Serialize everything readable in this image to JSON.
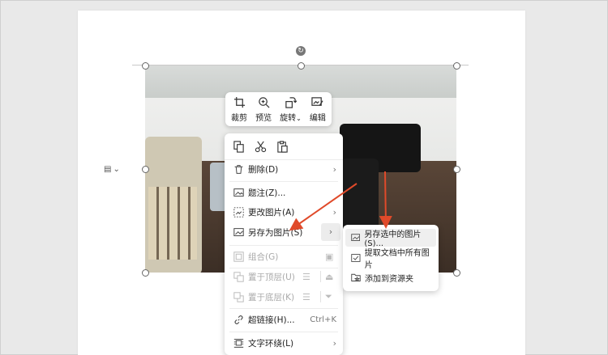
{
  "toolbar": {
    "crop": "裁剪",
    "preview": "预览",
    "rotate": "旋转",
    "edit": "编辑"
  },
  "context_menu": {
    "items": [
      {
        "label": "删除(D)",
        "icon": "trash-icon",
        "has_submenu": true
      },
      {
        "label": "题注(Z)...",
        "icon": "caption-icon"
      },
      {
        "label": "更改图片(A)",
        "icon": "change-image-icon",
        "has_submenu": true
      },
      {
        "label": "另存为图片(S)",
        "icon": "save-image-icon",
        "has_submenu": true
      },
      {
        "label": "组合(G)",
        "icon": "group-icon",
        "disabled": true
      },
      {
        "label": "置于顶层(U)",
        "icon": "bring-front-icon",
        "disabled": true
      },
      {
        "label": "置于底层(K)",
        "icon": "send-back-icon",
        "disabled": true
      },
      {
        "label": "超链接(H)...",
        "icon": "link-icon",
        "shortcut": "Ctrl+K"
      },
      {
        "label": "文字环绕(L)",
        "icon": "text-wrap-icon",
        "has_submenu": true
      }
    ]
  },
  "submenu": {
    "items": [
      {
        "label": "另存选中的图片(S)...",
        "highlighted": true
      },
      {
        "label": "提取文档中所有图片"
      },
      {
        "label": "添加到资源夹"
      }
    ]
  },
  "colors": {
    "arrow": "#e04a2a",
    "page": "#ffffff",
    "background": "#e9e9e9"
  }
}
